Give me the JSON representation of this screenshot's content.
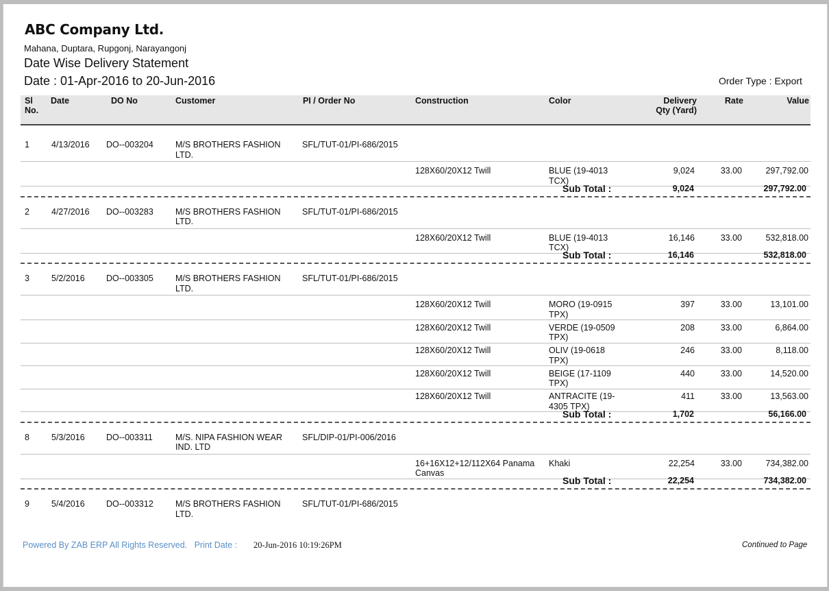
{
  "header": {
    "company": "ABC Company Ltd.",
    "address": "Mahana, Duptara, Rupgonj, Narayangonj",
    "report_title": "Date Wise Delivery Statement",
    "date_range": "Date : 01-Apr-2016 to 20-Jun-2016",
    "order_type": "Order Type : Export"
  },
  "columns": {
    "sl_1": "Sl",
    "sl_2": "No.",
    "date": "Date",
    "do_no": "DO No",
    "customer": "Customer",
    "pi": "PI / Order No",
    "construction": "Construction",
    "color": "Color",
    "qty_1": "Delivery",
    "qty_2": "Qty (Yard)",
    "rate": "Rate",
    "value": "Value"
  },
  "subtotal_label": "Sub Total :",
  "groups": [
    {
      "sl": "1",
      "date": "4/13/2016",
      "do_no": "DO--003204",
      "customer_1": "M/S BROTHERS FASHION",
      "customer_2": "LTD.",
      "pi": "SFL/TUT-01/PI-686/2015",
      "items": [
        {
          "construction_1": "128X60/20X12  Twill",
          "construction_2": "",
          "color_1": "BLUE (19-4013",
          "color_2": "TCX)",
          "qty": "9,024",
          "rate": "33.00",
          "value": "297,792.00"
        }
      ],
      "sub_qty": "9,024",
      "sub_value": "297,792.00"
    },
    {
      "sl": "2",
      "date": "4/27/2016",
      "do_no": "DO--003283",
      "customer_1": "M/S BROTHERS FASHION",
      "customer_2": "LTD.",
      "pi": "SFL/TUT-01/PI-686/2015",
      "items": [
        {
          "construction_1": "128X60/20X12  Twill",
          "construction_2": "",
          "color_1": "BLUE (19-4013",
          "color_2": "TCX)",
          "qty": "16,146",
          "rate": "33.00",
          "value": "532,818.00"
        }
      ],
      "sub_qty": "16,146",
      "sub_value": "532,818.00"
    },
    {
      "sl": "3",
      "date": "5/2/2016",
      "do_no": "DO--003305",
      "customer_1": "M/S BROTHERS FASHION",
      "customer_2": "LTD.",
      "pi": "SFL/TUT-01/PI-686/2015",
      "items": [
        {
          "construction_1": "128X60/20X12  Twill",
          "construction_2": "",
          "color_1": "MORO (19-0915",
          "color_2": "TPX)",
          "qty": "397",
          "rate": "33.00",
          "value": "13,101.00"
        },
        {
          "construction_1": "128X60/20X12  Twill",
          "construction_2": "",
          "color_1": "VERDE (19-0509",
          "color_2": "TPX)",
          "qty": "208",
          "rate": "33.00",
          "value": "6,864.00"
        },
        {
          "construction_1": "128X60/20X12  Twill",
          "construction_2": "",
          "color_1": "OLIV (19-0618",
          "color_2": "TPX)",
          "qty": "246",
          "rate": "33.00",
          "value": "8,118.00"
        },
        {
          "construction_1": "128X60/20X12  Twill",
          "construction_2": "",
          "color_1": "BEIGE (17-1109",
          "color_2": "TPX)",
          "qty": "440",
          "rate": "33.00",
          "value": "14,520.00"
        },
        {
          "construction_1": "128X60/20X12  Twill",
          "construction_2": "",
          "color_1": "ANTRACITE (19-",
          "color_2": "4305 TPX)",
          "qty": "411",
          "rate": "33.00",
          "value": "13,563.00"
        }
      ],
      "sub_qty": "1,702",
      "sub_value": "56,166.00"
    },
    {
      "sl": "8",
      "date": "5/3/2016",
      "do_no": "DO--003311",
      "customer_1": "M/S. NIPA FASHION WEAR",
      "customer_2": "IND. LTD",
      "pi": "SFL/DIP-01/PI-006/2016",
      "items": [
        {
          "construction_1": "16+16X12+12/112X64  Panama",
          "construction_2": "Canvas",
          "color_1": "Khaki",
          "color_2": "",
          "qty": "22,254",
          "rate": "33.00",
          "value": "734,382.00"
        }
      ],
      "sub_qty": "22,254",
      "sub_value": "734,382.00"
    },
    {
      "sl": "9",
      "date": "5/4/2016",
      "do_no": "DO--003312",
      "customer_1": "M/S BROTHERS FASHION",
      "customer_2": "LTD.",
      "pi": "SFL/TUT-01/PI-686/2015",
      "items": [],
      "sub_qty": "",
      "sub_value": ""
    }
  ],
  "footer": {
    "powered_by": "Powered By ZAB ERP  All Rights Reserved.",
    "print_date_label": "Print Date :",
    "print_date": "20-Jun-2016 10:19:26PM",
    "continued": "Continued to Page"
  }
}
